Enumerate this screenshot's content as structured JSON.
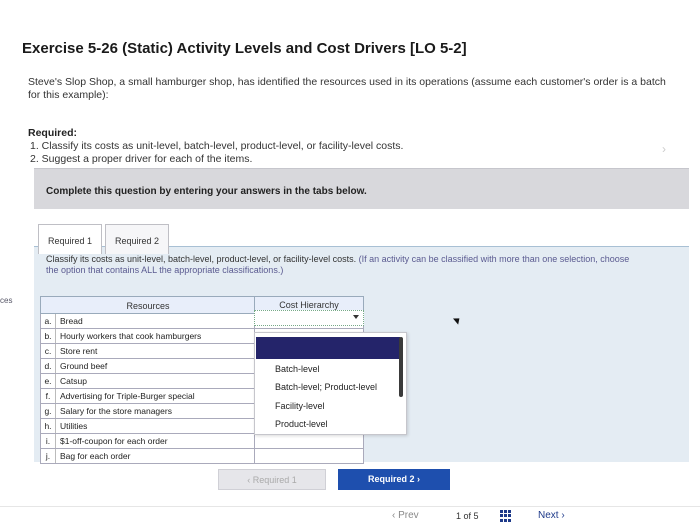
{
  "side_tab": "ces",
  "title": "Exercise 5-26 (Static) Activity Levels and Cost Drivers [LO 5-2]",
  "intro": "Steve's Slop Shop, a small hamburger shop, has identified the resources used in its operations (assume each customer's order is a batch for this example):",
  "required": {
    "heading": "Required:",
    "items": [
      "1. Classify its costs as unit-level, batch-level, product-level, or facility-level costs.",
      "2. Suggest a proper driver for each of the items."
    ]
  },
  "banner": "Complete this question by entering your answers in the tabs below.",
  "tabs": [
    "Required 1",
    "Required 2"
  ],
  "instruction": "Classify its costs as unit-level, batch-level, product-level, or facility-level costs.",
  "instruction_paren": "(If an activity can be classified with more than one selection, choose the option that contains ALL the appropriate classifications.)",
  "table": {
    "headers": [
      "Resources",
      "Cost Hierarchy"
    ],
    "rows": [
      {
        "letter": "a.",
        "resource": "Bread"
      },
      {
        "letter": "b.",
        "resource": "Hourly workers that cook hamburgers"
      },
      {
        "letter": "c.",
        "resource": "Store rent"
      },
      {
        "letter": "d.",
        "resource": "Ground beef"
      },
      {
        "letter": "e.",
        "resource": "Catsup"
      },
      {
        "letter": "f.",
        "resource": "Advertising for Triple-Burger special"
      },
      {
        "letter": "g.",
        "resource": "Salary for the store managers"
      },
      {
        "letter": "h.",
        "resource": "Utilities"
      },
      {
        "letter": "i.",
        "resource": "$1-off-coupon for each order"
      },
      {
        "letter": "j.",
        "resource": "Bag for each order"
      }
    ]
  },
  "dropdown_options": [
    "Batch-level",
    "Batch-level; Product-level",
    "Facility-level",
    "Product-level"
  ],
  "buttons": {
    "prev_req": "Required 1",
    "next_req": "Required 2"
  },
  "footer": {
    "prev": "Prev",
    "page": "1 of 5",
    "next": "Next"
  }
}
